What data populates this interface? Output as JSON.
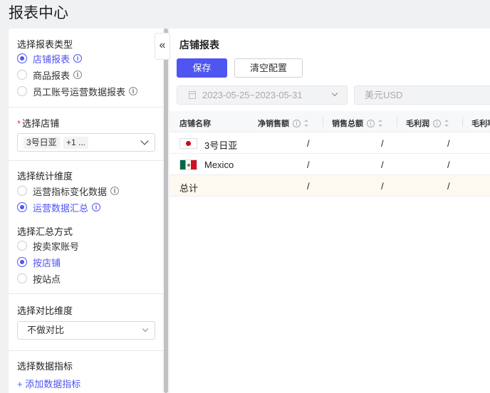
{
  "page_title": "报表中心",
  "left": {
    "report_type": {
      "title": "选择报表类型",
      "options": [
        {
          "label": "店铺报表",
          "checked": true
        },
        {
          "label": "商品报表",
          "checked": false
        },
        {
          "label": "员工账号运营数据报表",
          "checked": false
        }
      ]
    },
    "store": {
      "title": "选择店铺",
      "required_mark": "*",
      "selected_tag": "3号日亚",
      "more_tag": "+1 ..."
    },
    "stat_dimension": {
      "title": "选择统计维度",
      "options": [
        {
          "label": "运营指标变化数据",
          "checked": false
        },
        {
          "label": "运营数据汇总",
          "checked": true
        }
      ]
    },
    "summary_method": {
      "title": "选择汇总方式",
      "options": [
        {
          "label": "按卖家账号",
          "checked": false
        },
        {
          "label": "按店铺",
          "checked": true
        },
        {
          "label": "按站点",
          "checked": false
        }
      ]
    },
    "compare_dimension": {
      "title": "选择对比维度",
      "value": "不做对比"
    },
    "metrics": {
      "title": "选择数据指标",
      "add_label": "+ 添加数据指标"
    },
    "collapse_label": "«"
  },
  "right": {
    "title": "店铺报表",
    "save_label": "保存",
    "clear_label": "清空配置",
    "date_range": "2023-05-25~2023-05-31",
    "currency_placeholder": "美元USD",
    "table": {
      "columns": [
        "店铺名称",
        "净销售额",
        "销售总额",
        "毛利润",
        "毛利率"
      ],
      "rows": [
        {
          "name": "3号日亚",
          "flag": "japan-flag",
          "values": [
            "/",
            "/",
            "/"
          ]
        },
        {
          "name": "Mexico",
          "flag": "mexico-flag",
          "values": [
            "/",
            "/",
            "/"
          ]
        }
      ],
      "total": {
        "name": "总计",
        "values": [
          "/",
          "/",
          "/"
        ]
      }
    }
  },
  "colors": {
    "accent": "#4f55f1",
    "required": "#e53935",
    "total_row_bg": "#fdf8f0"
  }
}
